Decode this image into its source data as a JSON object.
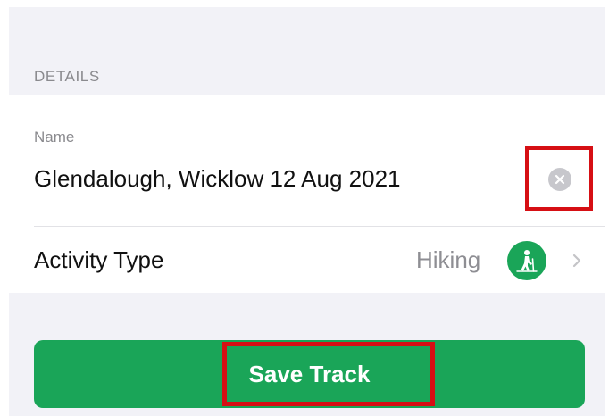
{
  "details_section": {
    "header": "DETAILS"
  },
  "name_field": {
    "label": "Name",
    "value": "Glendalough, Wicklow 12 Aug 2021",
    "clear_icon": "clear-circle-x-icon"
  },
  "activity_type": {
    "label": "Activity Type",
    "value": "Hiking",
    "icon": "hiking-person-icon",
    "chevron_icon": "chevron-right-icon"
  },
  "save_button": {
    "label": "Save Track"
  },
  "colors": {
    "accent_green": "#1aa558",
    "highlight_red": "#d60f14",
    "background_gray": "#f2f2f7",
    "secondary_text": "#8a8a8e"
  }
}
